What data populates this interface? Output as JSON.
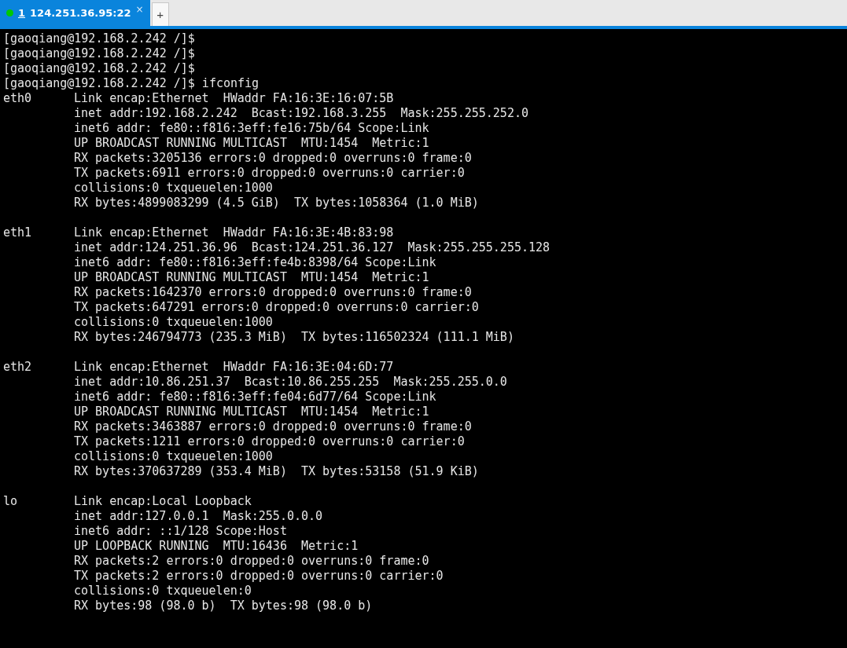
{
  "tabs": [
    {
      "number": "1",
      "title": "124.251.36.95:22",
      "selected": true,
      "color": "#00c800",
      "close": "×"
    }
  ],
  "new_tab": "+",
  "terminal": {
    "prompt_lines": [
      "[gaoqiang@192.168.2.242 /]$",
      "[gaoqiang@192.168.2.242 /]$",
      "[gaoqiang@192.168.2.242 /]$",
      "[gaoqiang@192.168.2.242 /]$ ifconfig"
    ],
    "interfaces": [
      {
        "name": "eth0",
        "lines": [
          "Link encap:Ethernet  HWaddr FA:16:3E:16:07:5B",
          "inet addr:192.168.2.242  Bcast:192.168.3.255  Mask:255.255.252.0",
          "inet6 addr: fe80::f816:3eff:fe16:75b/64 Scope:Link",
          "UP BROADCAST RUNNING MULTICAST  MTU:1454  Metric:1",
          "RX packets:3205136 errors:0 dropped:0 overruns:0 frame:0",
          "TX packets:6911 errors:0 dropped:0 overruns:0 carrier:0",
          "collisions:0 txqueuelen:1000",
          "RX bytes:4899083299 (4.5 GiB)  TX bytes:1058364 (1.0 MiB)"
        ]
      },
      {
        "name": "eth1",
        "lines": [
          "Link encap:Ethernet  HWaddr FA:16:3E:4B:83:98",
          "inet addr:124.251.36.96  Bcast:124.251.36.127  Mask:255.255.255.128",
          "inet6 addr: fe80::f816:3eff:fe4b:8398/64 Scope:Link",
          "UP BROADCAST RUNNING MULTICAST  MTU:1454  Metric:1",
          "RX packets:1642370 errors:0 dropped:0 overruns:0 frame:0",
          "TX packets:647291 errors:0 dropped:0 overruns:0 carrier:0",
          "collisions:0 txqueuelen:1000",
          "RX bytes:246794773 (235.3 MiB)  TX bytes:116502324 (111.1 MiB)"
        ]
      },
      {
        "name": "eth2",
        "lines": [
          "Link encap:Ethernet  HWaddr FA:16:3E:04:6D:77",
          "inet addr:10.86.251.37  Bcast:10.86.255.255  Mask:255.255.0.0",
          "inet6 addr: fe80::f816:3eff:fe04:6d77/64 Scope:Link",
          "UP BROADCAST RUNNING MULTICAST  MTU:1454  Metric:1",
          "RX packets:3463887 errors:0 dropped:0 overruns:0 frame:0",
          "TX packets:1211 errors:0 dropped:0 overruns:0 carrier:0",
          "collisions:0 txqueuelen:1000",
          "RX bytes:370637289 (353.4 MiB)  TX bytes:53158 (51.9 KiB)"
        ]
      },
      {
        "name": "lo",
        "lines": [
          "Link encap:Local Loopback",
          "inet addr:127.0.0.1  Mask:255.0.0.0",
          "inet6 addr: ::1/128 Scope:Host",
          "UP LOOPBACK RUNNING  MTU:16436  Metric:1",
          "RX packets:2 errors:0 dropped:0 overruns:0 frame:0",
          "TX packets:2 errors:0 dropped:0 overruns:0 carrier:0",
          "collisions:0 txqueuelen:0",
          "RX bytes:98 (98.0 b)  TX bytes:98 (98.0 b)"
        ]
      }
    ]
  }
}
